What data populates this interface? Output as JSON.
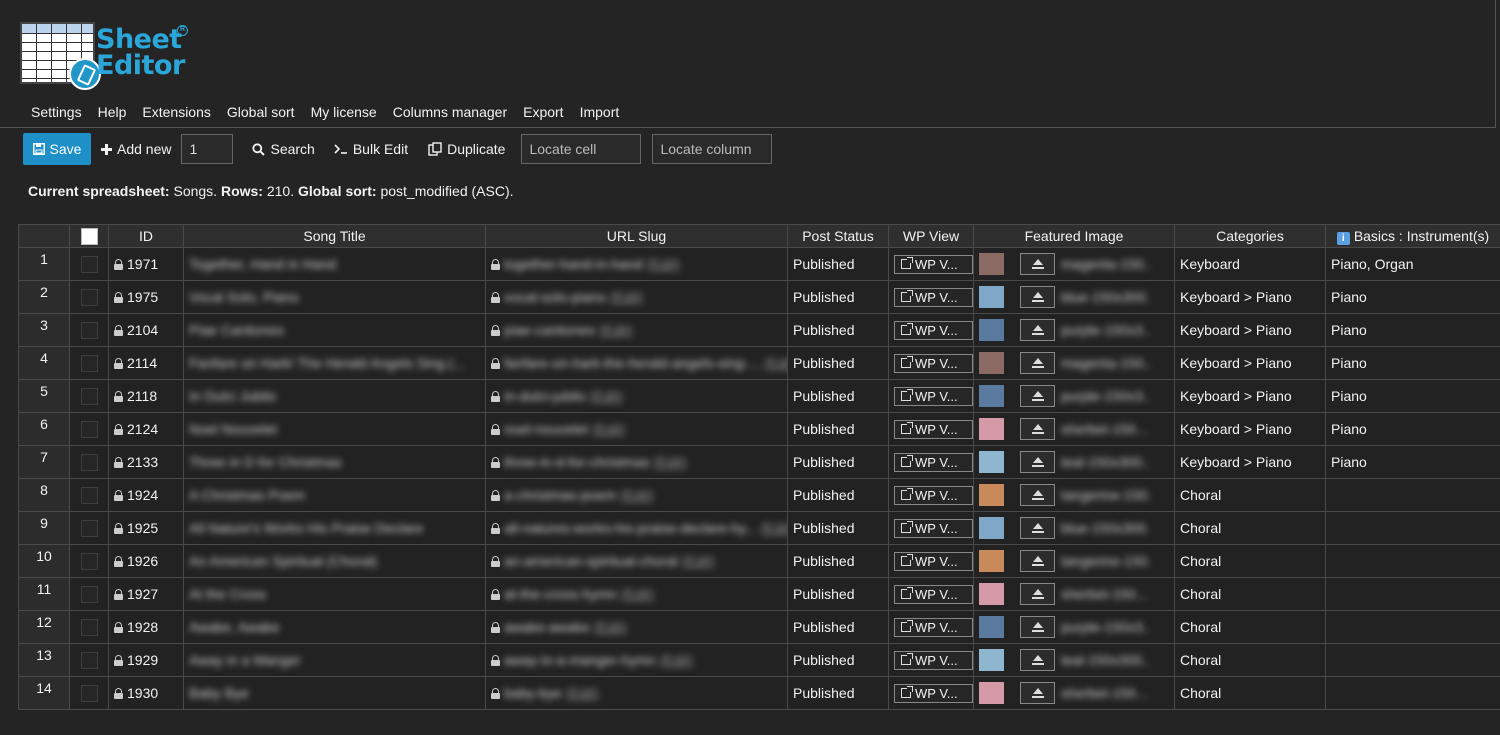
{
  "logo": {
    "line1": "Sheet",
    "line2": "Editor",
    "mark": "R"
  },
  "menu": [
    "Settings",
    "Help",
    "Extensions",
    "Global sort",
    "My license",
    "Columns manager",
    "Export",
    "Import"
  ],
  "toolbar": {
    "save_label": "Save",
    "add_new_label": "Add new",
    "add_new_count": "1",
    "search_label": "Search",
    "bulk_edit_label": "Bulk Edit",
    "duplicate_label": "Duplicate",
    "locate_cell_placeholder": "Locate cell",
    "locate_column_placeholder": "Locate column"
  },
  "summary": {
    "label1": "Current spreadsheet:",
    "spreadsheet": " Songs.",
    "label2": " Rows:",
    "rows": " 210.",
    "label3": " Global sort:",
    "sort": " post_modified (ASC)."
  },
  "columns": [
    "",
    "",
    "ID",
    "Song Title",
    "URL Slug",
    "Post Status",
    "WP View",
    "Featured Image",
    "Categories",
    "Basics : Instrument(s)"
  ],
  "wp_view_label": "WP V...",
  "slug_edit_label": "(Edit)",
  "rows": [
    {
      "n": "1",
      "id": "1971",
      "title": "Together, Hand in Hand",
      "slug": "together-hand-in-hand",
      "status": "Published",
      "img": "magenta-150...",
      "thumb": "#8a6a62",
      "cat": "Keyboard",
      "inst": "Piano, Organ"
    },
    {
      "n": "2",
      "id": "1975",
      "title": "Vocal Solo, Piano",
      "slug": "vocal-solo-piano",
      "status": "Published",
      "img": "blue-150x300...",
      "thumb": "#7fa8c8",
      "cat": "Keyboard > Piano",
      "inst": "Piano"
    },
    {
      "n": "3",
      "id": "2104",
      "title": "Piae Cantiones",
      "slug": "piae-cantiones",
      "status": "Published",
      "img": "purple-150x3...",
      "thumb": "#5a7aa0",
      "cat": "Keyboard > Piano",
      "inst": "Piano"
    },
    {
      "n": "4",
      "id": "2114",
      "title": "Fanfare on Hark! The Herald Angels Sing (...",
      "slug": "fanfare-on-hark-the-herald-angels-sing-...",
      "status": "Published",
      "img": "magenta-150...",
      "thumb": "#8a6a62",
      "cat": "Keyboard > Piano",
      "inst": "Piano"
    },
    {
      "n": "5",
      "id": "2118",
      "title": "In Dulci Jubilo",
      "slug": "in-dulci-jubilo",
      "status": "Published",
      "img": "purple-150x3...",
      "thumb": "#5a7aa0",
      "cat": "Keyboard > Piano",
      "inst": "Piano"
    },
    {
      "n": "6",
      "id": "2124",
      "title": "Noel Nouvelet",
      "slug": "noel-nouvelet",
      "status": "Published",
      "img": "sherbet-150...",
      "thumb": "#d49aa8",
      "cat": "Keyboard > Piano",
      "inst": "Piano"
    },
    {
      "n": "7",
      "id": "2133",
      "title": "Three in D for Christmas",
      "slug": "three-in-d-for-christmas",
      "status": "Published",
      "img": "teal-150x300...",
      "thumb": "#8fb6cf",
      "cat": "Keyboard > Piano",
      "inst": "Piano"
    },
    {
      "n": "8",
      "id": "1924",
      "title": "A Christmas Poem",
      "slug": "a-christmas-poem",
      "status": "Published",
      "img": "tangerine-150...",
      "thumb": "#c88a5a",
      "cat": "Choral",
      "inst": ""
    },
    {
      "n": "9",
      "id": "1925",
      "title": "All Nature's Works His Praise Declare",
      "slug": "all-natures-works-his-praise-declare-hy...",
      "status": "Published",
      "img": "blue-150x300...",
      "thumb": "#7fa8c8",
      "cat": "Choral",
      "inst": ""
    },
    {
      "n": "10",
      "id": "1926",
      "title": "An American Spiritual (Choral)",
      "slug": "an-american-spiritual-choral",
      "status": "Published",
      "img": "tangerine-150...",
      "thumb": "#c88a5a",
      "cat": "Choral",
      "inst": ""
    },
    {
      "n": "11",
      "id": "1927",
      "title": "At the Cross",
      "slug": "at-the-cross-hymn",
      "status": "Published",
      "img": "sherbet-150...",
      "thumb": "#d49aa8",
      "cat": "Choral",
      "inst": ""
    },
    {
      "n": "12",
      "id": "1928",
      "title": "Awake, Awake",
      "slug": "awake-awake",
      "status": "Published",
      "img": "purple-150x3...",
      "thumb": "#5a7aa0",
      "cat": "Choral",
      "inst": ""
    },
    {
      "n": "13",
      "id": "1929",
      "title": "Away in a Manger",
      "slug": "away-in-a-manger-hymn",
      "status": "Published",
      "img": "teal-150x300...",
      "thumb": "#8fb6cf",
      "cat": "Choral",
      "inst": ""
    },
    {
      "n": "14",
      "id": "1930",
      "title": "Baby Bye",
      "slug": "baby-bye",
      "status": "Published",
      "img": "sherbet-150...",
      "thumb": "#d49aa8",
      "cat": "Choral",
      "inst": ""
    }
  ]
}
